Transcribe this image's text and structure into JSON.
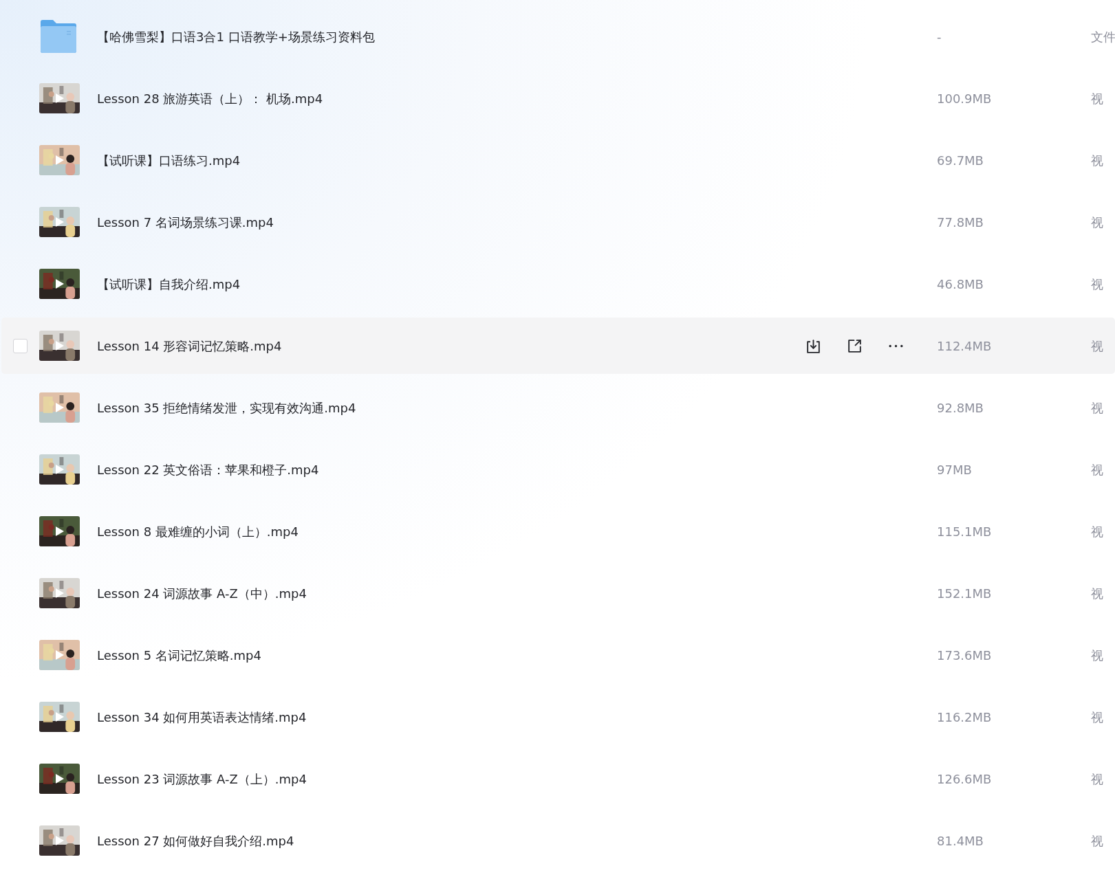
{
  "rows": [
    {
      "kind": "folder",
      "name": "【哈佛雪梨】口语3合1 口语教学+场景练习资料包",
      "size": "-",
      "type": "文件",
      "hovered": false
    },
    {
      "kind": "video",
      "name": "Lesson 28 旅游英语（上）： 机场.mp4",
      "size": "100.9MB",
      "type": "视",
      "hovered": false
    },
    {
      "kind": "video",
      "name": "【试听课】口语练习.mp4",
      "size": "69.7MB",
      "type": "视",
      "hovered": false
    },
    {
      "kind": "video",
      "name": "Lesson 7 名词场景练习课.mp4",
      "size": "77.8MB",
      "type": "视",
      "hovered": false
    },
    {
      "kind": "video",
      "name": "【试听课】自我介绍.mp4",
      "size": "46.8MB",
      "type": "视",
      "hovered": false
    },
    {
      "kind": "video",
      "name": "Lesson 14 形容词记忆策略.mp4",
      "size": "112.4MB",
      "type": "视",
      "hovered": true
    },
    {
      "kind": "video",
      "name": "Lesson 35 拒绝情绪发泄，实现有效沟通.mp4",
      "size": "92.8MB",
      "type": "视",
      "hovered": false
    },
    {
      "kind": "video",
      "name": "Lesson 22 英文俗语：苹果和橙子.mp4",
      "size": "97MB",
      "type": "视",
      "hovered": false
    },
    {
      "kind": "video",
      "name": "Lesson 8 最难缠的小词（上）.mp4",
      "size": "115.1MB",
      "type": "视",
      "hovered": false
    },
    {
      "kind": "video",
      "name": "Lesson 24 词源故事 A-Z（中）.mp4",
      "size": "152.1MB",
      "type": "视",
      "hovered": false
    },
    {
      "kind": "video",
      "name": "Lesson 5 名词记忆策略.mp4",
      "size": "173.6MB",
      "type": "视",
      "hovered": false
    },
    {
      "kind": "video",
      "name": "Lesson 34 如何用英语表达情绪.mp4",
      "size": "116.2MB",
      "type": "视",
      "hovered": false
    },
    {
      "kind": "video",
      "name": "Lesson 23 词源故事 A-Z（上）.mp4",
      "size": "126.6MB",
      "type": "视",
      "hovered": false
    },
    {
      "kind": "video",
      "name": "Lesson 27 如何做好自我介绍.mp4",
      "size": "81.4MB",
      "type": "视",
      "hovered": false
    }
  ]
}
